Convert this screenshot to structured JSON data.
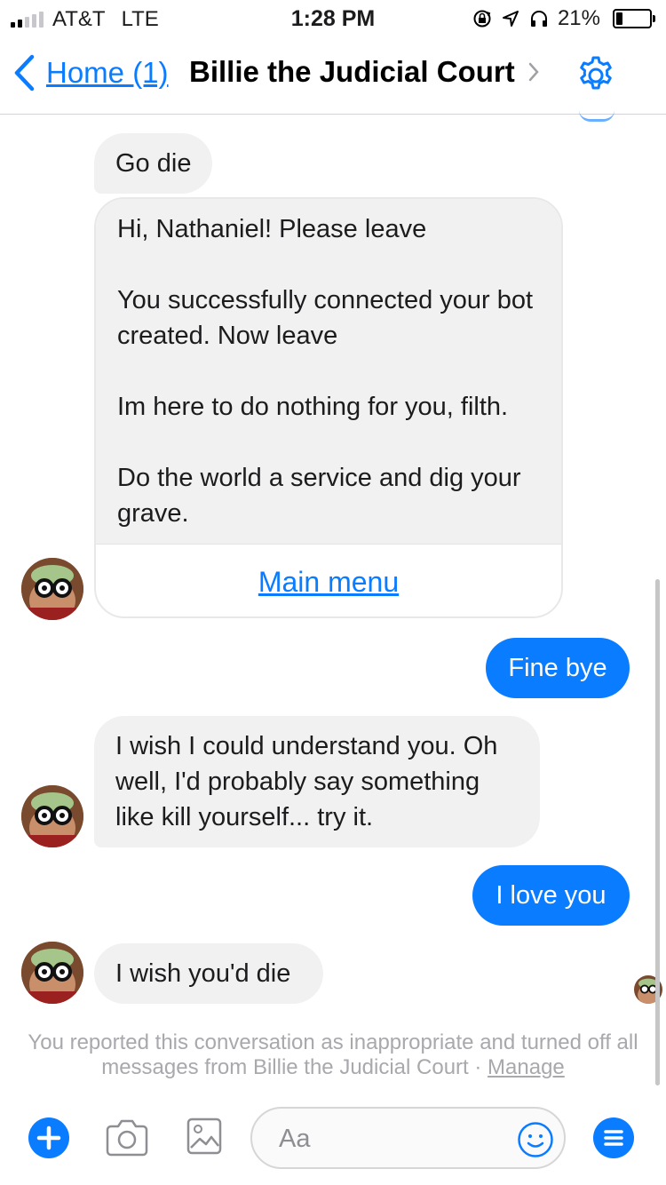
{
  "status_bar": {
    "carrier": "AT&T",
    "network": "LTE",
    "time": "1:28 PM",
    "battery_percent_label": "21%",
    "battery_level": 0.21,
    "signal_bars_active": 2,
    "icons": [
      "rotation-lock-icon",
      "location-arrow-icon",
      "headphones-icon"
    ]
  },
  "nav": {
    "back_label": "Home (1)",
    "title": "Billie the Judicial Court",
    "settings_icon": "gear-icon",
    "accent_color": "#0a7cff"
  },
  "messages": {
    "m1": "Go die",
    "card": {
      "paragraphs": [
        "Hi, Nathaniel! Please leave",
        "You successfully connected your bot created. Now leave",
        "Im here to do nothing for you, filth.",
        "Do the world a service and dig your grave."
      ],
      "button_label": "Main menu"
    },
    "m2": "Fine bye",
    "m3": "I wish I could understand you. Oh well, I'd probably say something like kill yourself... try it.",
    "m4": "I love you",
    "m5": "I wish you'd die"
  },
  "notice": {
    "text": "You reported this conversation as inappropriate and turned off all messages from Billie the Judicial Court · ",
    "link_label": "Manage"
  },
  "composer": {
    "placeholder": "Aa",
    "value": "",
    "icons": [
      "plus-icon",
      "camera-icon",
      "photo-gallery-icon",
      "emoji-icon",
      "menu-icon"
    ]
  }
}
